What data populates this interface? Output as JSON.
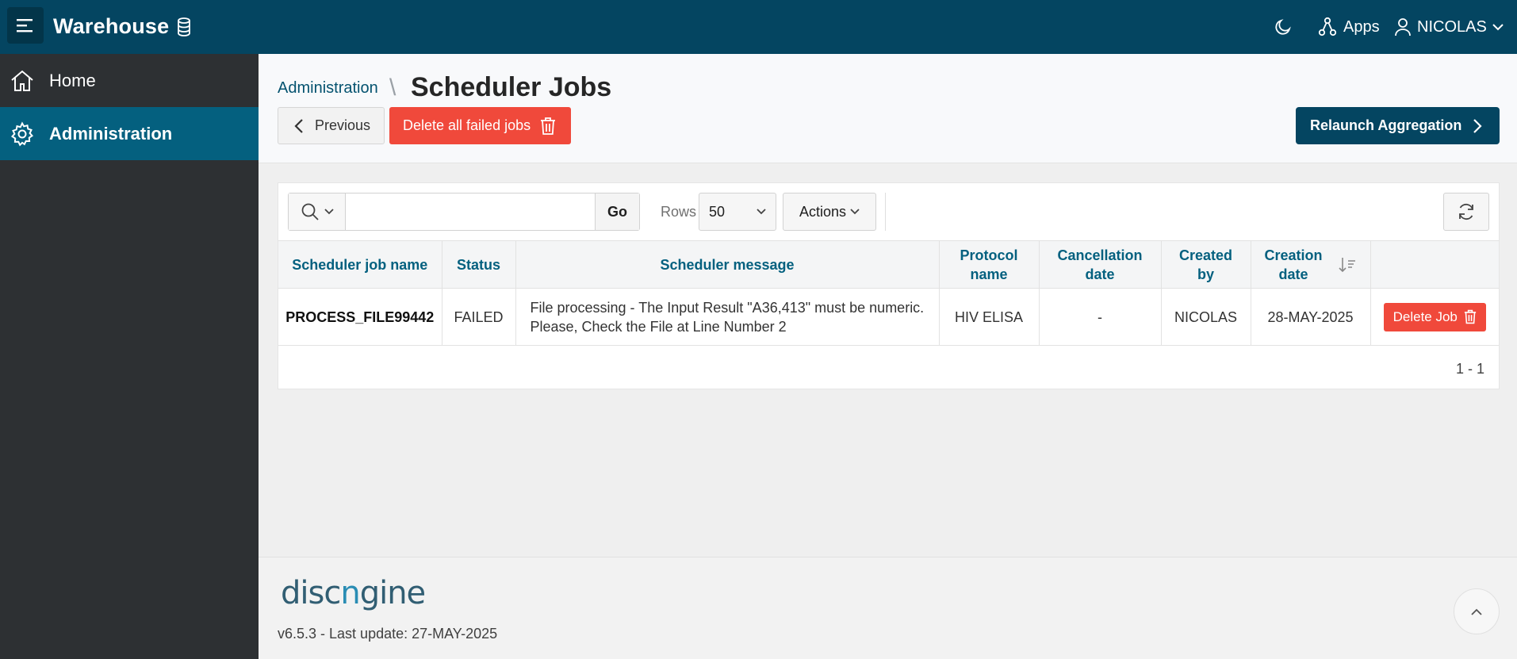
{
  "app": {
    "title": "Warehouse",
    "brand_icon": "database-icon",
    "theme_icon": "moon-icon",
    "apps_label": "Apps",
    "user_name": "NICOLAS"
  },
  "sidebar": {
    "items": [
      {
        "label": "Home",
        "icon": "home-icon",
        "active": false
      },
      {
        "label": "Administration",
        "icon": "gear-icon",
        "active": true
      }
    ]
  },
  "header": {
    "breadcrumb_parent": "Administration",
    "breadcrumb_separator": "\\",
    "title": "Scheduler Jobs",
    "previous_label": "Previous",
    "delete_all_label": "Delete all failed jobs",
    "relaunch_label": "Relaunch Aggregation"
  },
  "toolbar": {
    "search_value": "",
    "search_placeholder": "",
    "go_label": "Go",
    "rows_label": "Rows",
    "rows_value": "50",
    "actions_label": "Actions"
  },
  "table": {
    "columns": [
      {
        "line1": "Scheduler job name",
        "line2": ""
      },
      {
        "line1": "Status",
        "line2": ""
      },
      {
        "line1": "Scheduler message",
        "line2": ""
      },
      {
        "line1": "Protocol",
        "line2": "name"
      },
      {
        "line1": "Cancellation",
        "line2": "date"
      },
      {
        "line1": "Created",
        "line2": "by"
      },
      {
        "line1": "Creation",
        "line2": "date"
      }
    ],
    "rows": [
      {
        "job_name": "PROCESS_FILE99442",
        "status": "FAILED",
        "message_line1": "File processing - The Input Result \"A36,413\" must be numeric.",
        "message_line2": "Please, Check the File at Line Number 2",
        "protocol_name": "HIV ELISA",
        "cancellation_date": "-",
        "created_by": "NICOLAS",
        "creation_date": "28-MAY-2025",
        "delete_label": "Delete Job"
      }
    ],
    "pagination": "1 - 1"
  },
  "footer": {
    "logo_part1": "disc",
    "logo_part2": "n",
    "logo_part3": "gine",
    "version": "v6.5.3 - Last update: 27-MAY-2025"
  },
  "colors": {
    "topbar": "#044561",
    "sidebar": "#2d3033",
    "sidebar_active": "#04607f",
    "danger": "#f0493b",
    "link": "#04526f"
  }
}
